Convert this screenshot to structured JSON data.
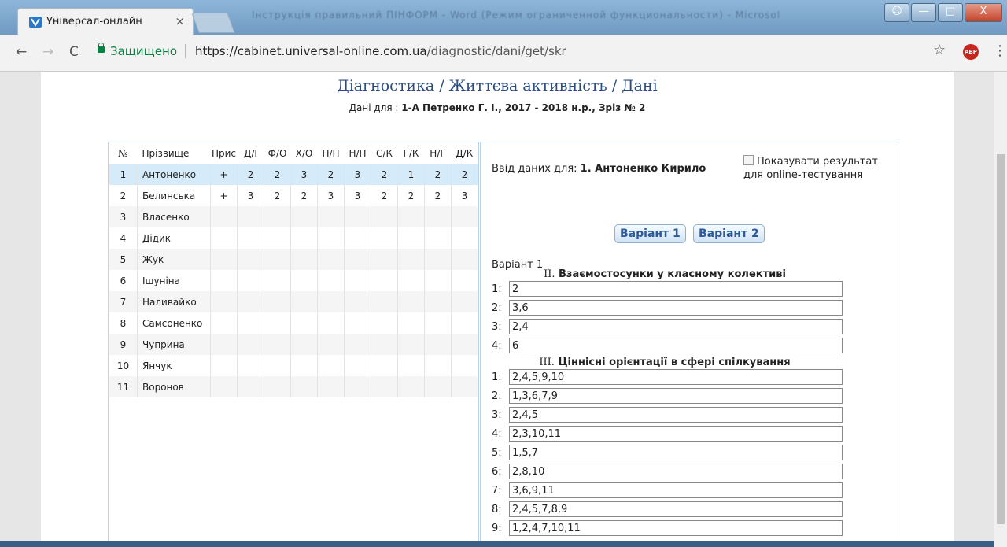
{
  "browser": {
    "tab_title": "Універсал-онлайн",
    "tab_close": "×",
    "background_window_title": "Інструкція правильний ПІНФОРМ - Word (Режим ограниченной функциональности) - Microsoft Word",
    "secure_label": "Защищено",
    "url_scheme_host": "https://cabinet.universal-online.com.ua",
    "url_path": "/diagnostic/dani/get/skr",
    "back": "←",
    "forward": "→",
    "reload": "C",
    "star": "☆",
    "abp": "ABP",
    "menu": "⋮",
    "win_min": "—",
    "win_max": "□",
    "win_close": "X"
  },
  "page": {
    "title": "Діагностика / Життєва активність / Дані",
    "subtitle_prefix": "Дані для : ",
    "subtitle_value": "1-А Петренко Г. І., 2017 - 2018 н.р., Зріз № 2"
  },
  "roster": {
    "headers": [
      "№",
      "Прізвище",
      "Прис",
      "Д/І",
      "Ф/О",
      "Х/О",
      "П/П",
      "Н/П",
      "С/К",
      "Г/К",
      "Н/Г",
      "Д/К"
    ],
    "rows": [
      [
        "1",
        "Антоненко",
        "+",
        "2",
        "2",
        "3",
        "2",
        "3",
        "2",
        "1",
        "2",
        "2"
      ],
      [
        "2",
        "Белинська",
        "+",
        "3",
        "2",
        "2",
        "3",
        "3",
        "2",
        "2",
        "2",
        "3"
      ],
      [
        "3",
        "Власенко",
        "",
        "",
        "",
        "",
        "",
        "",
        "",
        "",
        "",
        ""
      ],
      [
        "4",
        "Дідик",
        "",
        "",
        "",
        "",
        "",
        "",
        "",
        "",
        "",
        ""
      ],
      [
        "5",
        "Жук",
        "",
        "",
        "",
        "",
        "",
        "",
        "",
        "",
        "",
        ""
      ],
      [
        "6",
        "Ішуніна",
        "",
        "",
        "",
        "",
        "",
        "",
        "",
        "",
        "",
        ""
      ],
      [
        "7",
        "Наливайко",
        "",
        "",
        "",
        "",
        "",
        "",
        "",
        "",
        "",
        ""
      ],
      [
        "8",
        "Самсоненко",
        "",
        "",
        "",
        "",
        "",
        "",
        "",
        "",
        "",
        ""
      ],
      [
        "9",
        "Чуприна",
        "",
        "",
        "",
        "",
        "",
        "",
        "",
        "",
        "",
        ""
      ],
      [
        "10",
        "Янчук",
        "",
        "",
        "",
        "",
        "",
        "",
        "",
        "",
        "",
        ""
      ],
      [
        "11",
        "Воронов",
        "",
        "",
        "",
        "",
        "",
        "",
        "",
        "",
        "",
        ""
      ]
    ]
  },
  "entry": {
    "input_for_prefix": "Ввід даних для: ",
    "input_for_value": "1. Антоненко Кирило",
    "show_result_label": "Показувати результат для online-тестування",
    "variant1_button": "Варіант 1",
    "variant2_button": "Варіант 2",
    "variant_label": "Варіант 1",
    "section2_roman": "II.",
    "section2_title": "Взаємостосунки у класному колективі",
    "section2_rows": [
      {
        "n": "1:",
        "v": "2"
      },
      {
        "n": "2:",
        "v": "3,6"
      },
      {
        "n": "3:",
        "v": "2,4"
      },
      {
        "n": "4:",
        "v": "6"
      }
    ],
    "section3_roman": "III.",
    "section3_title": "Ціннісні орієнтації в сфері спілкування",
    "section3_rows": [
      {
        "n": "1:",
        "v": "2,4,5,9,10"
      },
      {
        "n": "2:",
        "v": "1,3,6,7,9"
      },
      {
        "n": "3:",
        "v": "2,4,5"
      },
      {
        "n": "4:",
        "v": "2,3,10,11"
      },
      {
        "n": "5:",
        "v": "1,5,7"
      },
      {
        "n": "6:",
        "v": "2,8,10"
      },
      {
        "n": "7:",
        "v": "3,6,9,11"
      },
      {
        "n": "8:",
        "v": "2,4,5,7,8,9"
      },
      {
        "n": "9:",
        "v": "1,2,4,7,10,11"
      }
    ]
  }
}
